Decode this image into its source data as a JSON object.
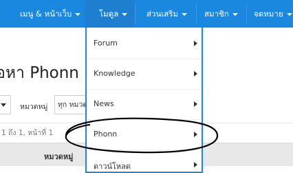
{
  "nav": {
    "items": [
      {
        "label": "เมนู & หน้าเว็บ"
      },
      {
        "label": "โมดูล"
      },
      {
        "label": "ส่วนเสริม"
      },
      {
        "label": "สมาชิก"
      },
      {
        "label": "จดหมาย"
      }
    ]
  },
  "page": {
    "title": "้อหา Phonn",
    "category_label": "หมวดหมู่",
    "category_value": "ทุก หมวดห",
    "pagination": "1 ถึง 1, หน้าที่ 1",
    "table_header_category": "หมวดหมู่"
  },
  "dropdown": {
    "items": [
      {
        "label": "Forum"
      },
      {
        "label": "Knowledge"
      },
      {
        "label": "News"
      },
      {
        "label": "Phonn"
      },
      {
        "label": "ดาวน์โหลด"
      }
    ]
  },
  "colors": {
    "navbar": "#1a88df",
    "annotation": "#000000"
  }
}
